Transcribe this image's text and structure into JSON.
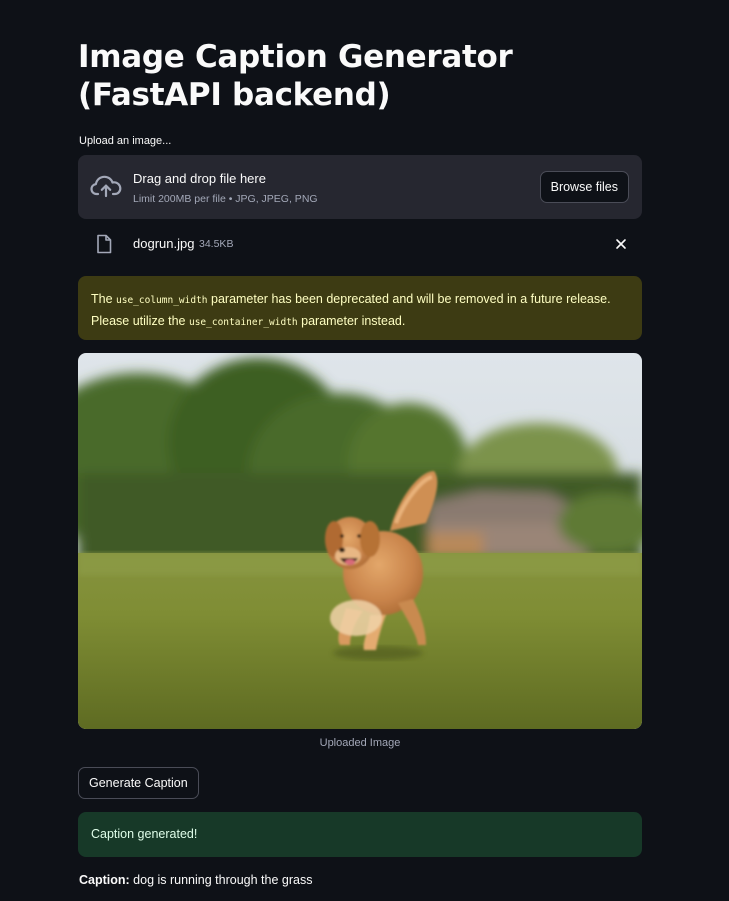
{
  "page": {
    "title": "Image Caption Generator (FastAPI backend)"
  },
  "uploader": {
    "label": "Upload an image...",
    "drop_text": "Drag and drop file here",
    "limit_text": "Limit 200MB per file • JPG, JPEG, PNG",
    "browse_label": "Browse files",
    "icon": "cloud-upload-icon"
  },
  "file": {
    "name": "dogrun.jpg",
    "size": "34.5KB",
    "icon": "file-icon",
    "remove_icon": "close-icon"
  },
  "warning": {
    "text_1": "The ",
    "code_1": "use_column_width",
    "text_2": " parameter has been deprecated and will be removed in a future release. Please utilize the ",
    "code_2": "use_container_width",
    "text_3": " parameter instead."
  },
  "image": {
    "caption": "Uploaded Image",
    "description": "golden retriever running on grass"
  },
  "actions": {
    "generate_label": "Generate Caption"
  },
  "result": {
    "success_message": "Caption generated!",
    "caption_label": "Caption:",
    "caption_text": " dog is running through the grass"
  },
  "colors": {
    "background": "#0e1117",
    "panel": "#262730",
    "warning_bg": "#3d3b13",
    "warning_text": "#ffffc2",
    "success_bg": "#173928",
    "success_text": "#dffde9"
  }
}
